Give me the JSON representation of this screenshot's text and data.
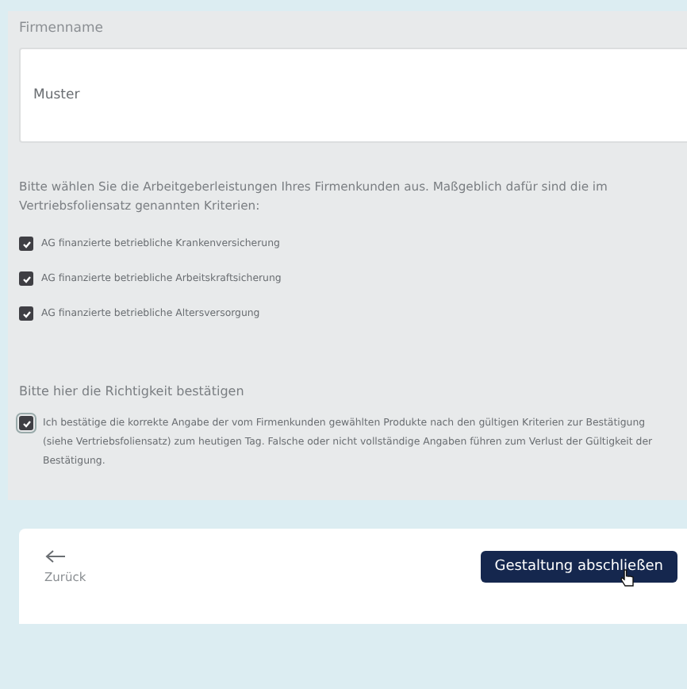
{
  "company_field": {
    "label": "Firmenname",
    "value": "Muster"
  },
  "benefits": {
    "intro": "Bitte wählen Sie die Arbeitgeberleistungen Ihres Firmenkunden aus. Maßgeblich dafür sind die im Vertriebsfoliensatz genannten Kriterien:",
    "options": [
      {
        "label": "AG finanzierte betriebliche Krankenversicherung",
        "checked": true
      },
      {
        "label": "AG finanzierte betriebliche Arbeitskraftsicherung",
        "checked": true
      },
      {
        "label": "AG finanzierte betriebliche Altersversorgung",
        "checked": true
      }
    ]
  },
  "confirmation": {
    "heading": "Bitte hier die Richtigkeit bestätigen",
    "text": "Ich bestätige die korrekte Angabe der vom Firmenkunden gewählten Produkte nach den gültigen Kriterien zur Bestätigung (siehe Vertriebsfoliensatz) zum heutigen Tag. Falsche oder nicht vollständige Angaben führen zum Verlust der Gültigkeit der Bestätigung.",
    "checked": true
  },
  "footer": {
    "back_label": "Zurück",
    "submit_label": "Gestaltung abschließen"
  }
}
